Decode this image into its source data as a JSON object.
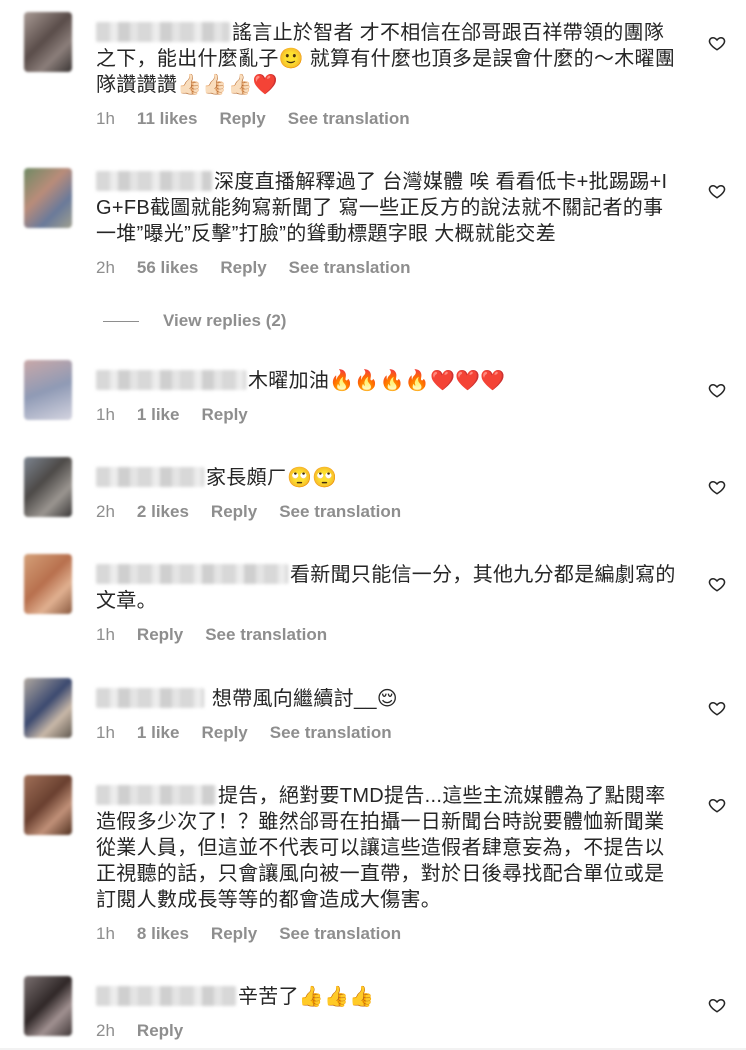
{
  "comments": [
    {
      "text": "謠言止於智者 才不相信在郃哥跟百祥帶領的團隊之下，能出什麼亂子🙂 就算有什麼也頂多是誤會什麼的～木曜團隊讚讚讚👍🏻👍🏻👍🏻❤️",
      "time": "1h",
      "likes": "11 likes",
      "reply": "Reply",
      "translate": "See translation"
    },
    {
      "text": "深度直播解釋過了 台灣媒體 唉 看看低卡+批踢踢+IG+FB截圖就能夠寫新聞了 寫一些正反方的說法就不關記者的事 一堆”曝光”反擊”打臉”的聳動標題字眼 大概就能交差",
      "time": "2h",
      "likes": "56 likes",
      "reply": "Reply",
      "translate": "See translation"
    },
    {
      "text": "木曜加油🔥🔥🔥🔥❤️❤️❤️",
      "time": "1h",
      "likes": "1 like",
      "reply": "Reply",
      "translate": ""
    },
    {
      "text": "家長頗ㄏ🙄🙄",
      "time": "2h",
      "likes": "2 likes",
      "reply": "Reply",
      "translate": "See translation"
    },
    {
      "text": "看新聞只能信一分，其他九分都是編劇寫的文章。",
      "time": "1h",
      "likes": "",
      "reply": "Reply",
      "translate": "See translation"
    },
    {
      "text": " 想帶風向繼續討__😌",
      "time": "1h",
      "likes": "1 like",
      "reply": "Reply",
      "translate": "See translation"
    },
    {
      "text": "提告，絕對要TMD提告...這些主流媒體為了點閱率造假多少次了！？雖然郃哥在拍攝一日新聞台時說要體恤新聞業從業人員，但這並不代表可以讓這些造假者肆意妄為，不提告以正視聽的話，只會讓風向被一直帶，對於日後尋找配合單位或是訂閱人數成長等等的都會造成大傷害。",
      "time": "1h",
      "likes": "8 likes",
      "reply": "Reply",
      "translate": "See translation"
    },
    {
      "text": "辛苦了👍👍👍",
      "time": "2h",
      "likes": "",
      "reply": "Reply",
      "translate": ""
    }
  ],
  "view_replies": "View replies (2)",
  "colors": {
    "meta": "#8e8e8e",
    "text": "#262626"
  }
}
